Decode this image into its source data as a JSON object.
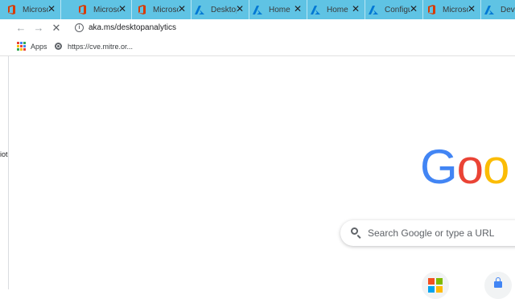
{
  "tabs": [
    {
      "title": "Microsoft",
      "icon": "office-icon"
    },
    {
      "title": "Microsoft",
      "icon": "office-icon"
    },
    {
      "title": "Microsoft",
      "icon": "office-icon"
    },
    {
      "title": "Desktop",
      "icon": "azure-icon"
    },
    {
      "title": "Home",
      "icon": "azure-icon"
    },
    {
      "title": "Home",
      "icon": "azure-icon"
    },
    {
      "title": "Configuration",
      "icon": "azure-icon"
    },
    {
      "title": "Microsoft",
      "icon": "office-icon"
    },
    {
      "title": "Devices",
      "icon": "azure-icon"
    }
  ],
  "toolbar": {
    "back_icon": "←",
    "forward_icon": "→",
    "stop_icon": "✕",
    "url": "aka.ms/desktopanalytics"
  },
  "bookmarks": {
    "apps_label": "Apps",
    "link_label": "https://cve.mitre.or..."
  },
  "page": {
    "edge_text": "iot",
    "logo_letters": [
      "G",
      "o",
      "o"
    ],
    "logo_colors": [
      "#4285F4",
      "#EA4335",
      "#FBBC05"
    ],
    "search_placeholder": "Search Google or type a URL"
  },
  "colors": {
    "tab_strip": "#5FC3E4",
    "office_red": "#D83B01",
    "azure_blue": "#0078D4"
  }
}
